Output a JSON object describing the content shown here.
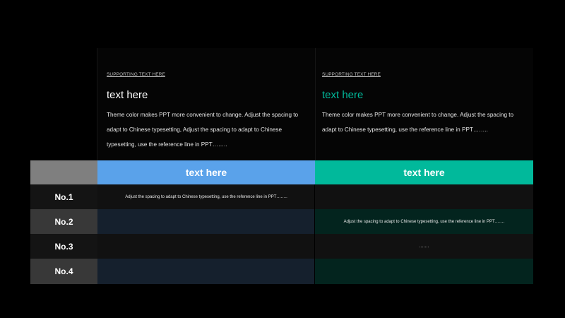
{
  "left_panel": {
    "supporting": "SUPPORTING TEXT HERE",
    "title": "text here",
    "body": "Theme color makes PPT more convenient to change. Adjust the spacing to adapt to Chinese typesetting, Adjust the spacing to adapt to Chinese typesetting, use the reference line in PPT……..",
    "title_color": "#ffffff"
  },
  "right_panel": {
    "supporting": "SUPPORTING TEXT HERE",
    "title": "text here",
    "body": "Theme color makes PPT more convenient to change. Adjust the spacing to adapt to Chinese typesetting, use the reference line in PPT……..",
    "title_color": "#01b99b"
  },
  "table": {
    "headers": [
      "",
      "text here",
      "text here"
    ],
    "rows": [
      {
        "label": "No.1",
        "cells": [
          "Adjust the spacing to adapt to Chinese typesetting, use the reference line in PPT……..",
          ""
        ]
      },
      {
        "label": "No.2",
        "cells": [
          "",
          "Adjust the spacing to adapt to Chinese typesetting, use the reference line in PPT……."
        ]
      },
      {
        "label": "No.3",
        "cells": [
          "",
          "……."
        ]
      },
      {
        "label": "No.4",
        "cells": [
          "",
          ""
        ]
      }
    ]
  },
  "colors": {
    "background": "#000000",
    "accent_blue": "#5aa2ea",
    "accent_green": "#01b99b",
    "header_gray": "#7f7f7f"
  }
}
